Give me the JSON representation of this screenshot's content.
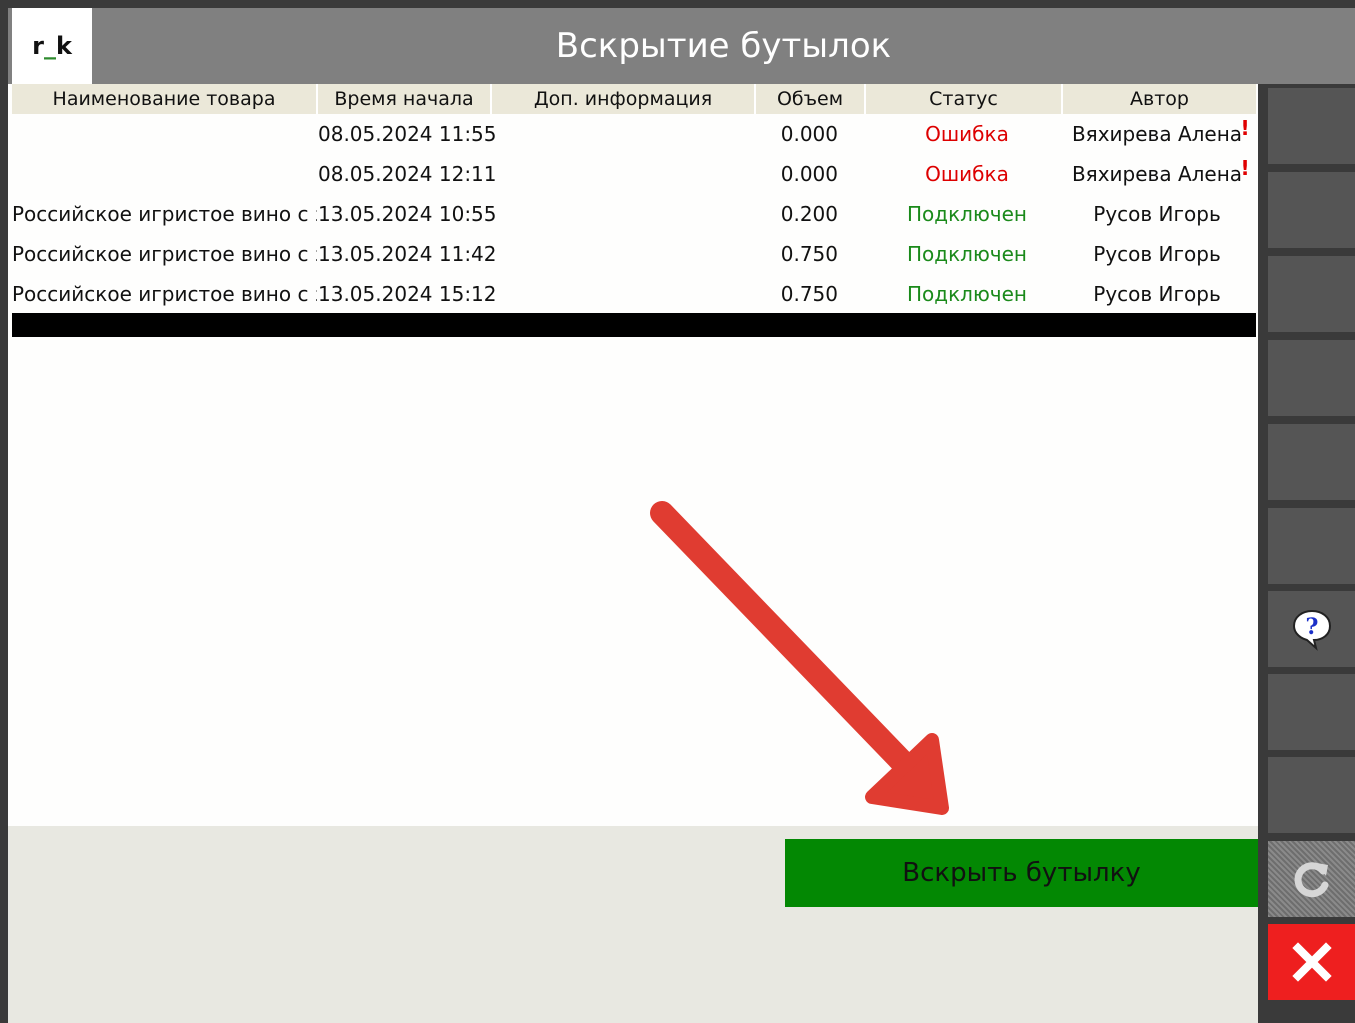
{
  "header": {
    "logo_left": "r",
    "logo_mid": "_",
    "logo_right": "k",
    "title": "Вскрытие бутылок"
  },
  "table": {
    "columns": [
      "Наименование товара",
      "Время начала",
      "Доп. информация",
      "Объем",
      "Статус",
      "Автор"
    ],
    "rows": [
      {
        "name": "",
        "time": "08.05.2024 11:55",
        "info": "",
        "volume": "0.000",
        "status": "Ошибка",
        "author": "Вяхирева Алена",
        "flag": "!"
      },
      {
        "name": "",
        "time": "08.05.2024 12:11",
        "info": "",
        "volume": "0.000",
        "status": "Ошибка",
        "author": "Вяхирева Алена",
        "flag": "!"
      },
      {
        "name": "Российское игристое вино с за",
        "time": "13.05.2024 10:55",
        "info": "",
        "volume": "0.200",
        "status": "Подключен",
        "author": "Русов Игорь",
        "flag": ""
      },
      {
        "name": "Российское игристое вино с за",
        "time": "13.05.2024 11:42",
        "info": "",
        "volume": "0.750",
        "status": "Подключен",
        "author": "Русов Игорь",
        "flag": ""
      },
      {
        "name": "Российское игристое вино с за",
        "time": "13.05.2024 15:12",
        "info": "",
        "volume": "0.750",
        "status": "Подключен",
        "author": "Русов Игорь",
        "flag": ""
      }
    ]
  },
  "actions": {
    "open_bottle_label": "Вскрыть бутылку"
  },
  "sidebar": {
    "help_icon": "help-bubble-icon",
    "refresh_icon": "refresh-icon",
    "close_icon": "close-icon"
  },
  "colors": {
    "status_error": "#dd0000",
    "status_ok": "#1a8a1a",
    "open_button": "#038803",
    "close_button": "#ee1f1f",
    "annotation_arrow": "#e03c31"
  }
}
